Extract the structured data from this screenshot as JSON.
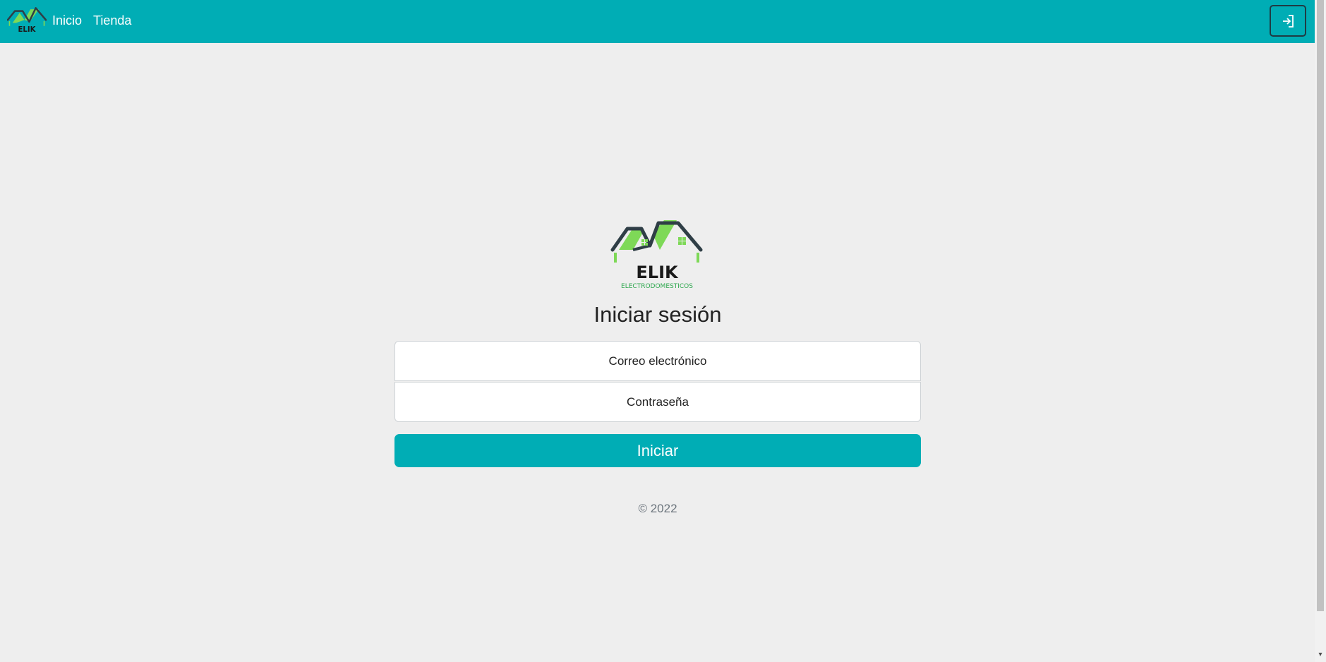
{
  "nav": {
    "links": [
      {
        "label": "Inicio"
      },
      {
        "label": "Tienda"
      }
    ],
    "login_icon": "login-arrow-icon",
    "bg_color": "#00adb5"
  },
  "brand": {
    "name": "ELIK",
    "tagline": "ELECTRODOMESTICOS",
    "roof_color": "#7ed957",
    "outline_color": "#2f3e46"
  },
  "form": {
    "title": "Iniciar sesión",
    "email_placeholder": "Correo electrónico",
    "password_placeholder": "Contraseña",
    "submit_label": "Iniciar"
  },
  "footer": {
    "copyright": "© 2022"
  }
}
